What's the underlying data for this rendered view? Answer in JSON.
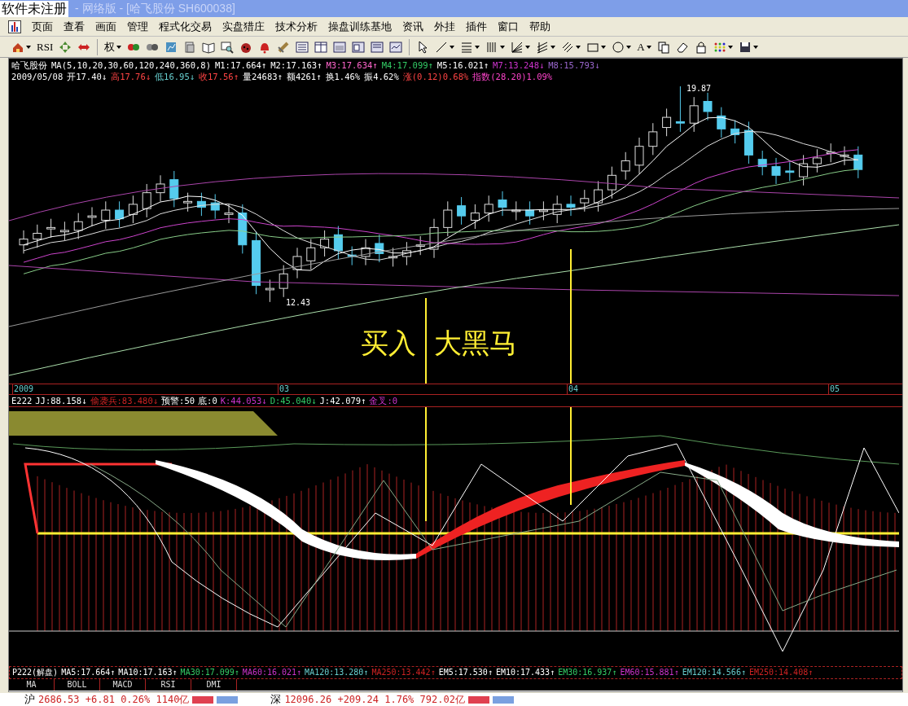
{
  "window": {
    "title_badge": "软件未注册",
    "title": "- 网络版 - [哈飞股份 SH600038]"
  },
  "menu": [
    "页面",
    "查看",
    "画面",
    "管理",
    "程式化交易",
    "实盘猎庄",
    "技术分析",
    "操盘训练基地",
    "资讯",
    "外挂",
    "插件",
    "窗口",
    "帮助"
  ],
  "toolbar": [
    {
      "kind": "icon",
      "dropdown": true
    },
    {
      "kind": "text",
      "label": "RSI",
      "dropdown": false
    },
    {
      "kind": "icon",
      "dropdown": false
    },
    {
      "kind": "icon",
      "dropdown": false
    },
    {
      "kind": "sep"
    },
    {
      "kind": "text",
      "label": "权",
      "dropdown": true
    },
    {
      "kind": "icon",
      "dropdown": false
    },
    {
      "kind": "icon",
      "dropdown": false
    },
    {
      "kind": "icon",
      "dropdown": false
    },
    {
      "kind": "icon",
      "dropdown": false
    },
    {
      "kind": "icon",
      "dropdown": false
    },
    {
      "kind": "icon",
      "dropdown": false
    },
    {
      "kind": "icon",
      "dropdown": false
    },
    {
      "kind": "icon",
      "dropdown": false
    },
    {
      "kind": "icon",
      "dropdown": false
    },
    {
      "kind": "icon",
      "dropdown": false
    },
    {
      "kind": "icon",
      "dropdown": false
    },
    {
      "kind": "icon",
      "dropdown": false
    },
    {
      "kind": "icon",
      "dropdown": false
    },
    {
      "kind": "icon",
      "dropdown": false
    },
    {
      "kind": "icon",
      "dropdown": false
    },
    {
      "kind": "sep"
    },
    {
      "kind": "icon",
      "dropdown": false
    },
    {
      "kind": "icon",
      "dropdown": true
    },
    {
      "kind": "icon",
      "dropdown": true
    },
    {
      "kind": "icon",
      "dropdown": true
    },
    {
      "kind": "icon",
      "dropdown": true
    },
    {
      "kind": "icon",
      "dropdown": true
    },
    {
      "kind": "icon",
      "dropdown": true
    },
    {
      "kind": "icon",
      "dropdown": true
    },
    {
      "kind": "icon",
      "dropdown": true
    },
    {
      "kind": "text",
      "label": "A",
      "dropdown": true
    },
    {
      "kind": "icon",
      "dropdown": false
    },
    {
      "kind": "icon",
      "dropdown": false
    },
    {
      "kind": "icon",
      "dropdown": false
    },
    {
      "kind": "icon",
      "dropdown": true
    },
    {
      "kind": "icon",
      "dropdown": true
    }
  ],
  "price_header": [
    [
      {
        "text": "哈飞股份",
        "kind": "white"
      },
      {
        "text": "MA(5,10,20,30,60,120,240,360,8)",
        "kind": "white"
      },
      {
        "text": "M1:17.664↑",
        "kind": "white"
      },
      {
        "text": "M2:17.163↑",
        "kind": "white"
      },
      {
        "text": "M3:17.634↑",
        "kind": "pink"
      },
      {
        "text": "M4:17.099↑",
        "kind": "green"
      },
      {
        "text": "M5:16.021↑",
        "kind": "white"
      },
      {
        "text": "M7:13.248↓",
        "kind": "violet"
      },
      {
        "text": "M8:15.793↓",
        "kind": "purple"
      }
    ],
    [
      {
        "text": "2009/05/08",
        "kind": "white"
      },
      {
        "text": "开17.40↓",
        "kind": "white"
      },
      {
        "text": "高17.76↓",
        "kind": "red"
      },
      {
        "text": "低16.95↓",
        "kind": "cyan"
      },
      {
        "text": "收17.56↑",
        "kind": "red"
      },
      {
        "text": "量24683↑",
        "kind": "white"
      },
      {
        "text": "额4261↑",
        "kind": "white"
      },
      {
        "text": "换1.46%",
        "kind": "white"
      },
      {
        "text": "振4.62%",
        "kind": "white"
      },
      {
        "text": "涨(0.12)0.68%",
        "kind": "red"
      },
      {
        "text": "指数(28.20)1.09%",
        "kind": "magenta"
      }
    ]
  ],
  "price_labels": {
    "high": "19.87",
    "low": "12.43"
  },
  "annotation": "买入  大黑马",
  "date_axis": [
    "2009",
    "03",
    "04",
    "05"
  ],
  "indicator_header": [
    {
      "text": "E222",
      "kind": "white"
    },
    {
      "text": "JJ:88.158↓",
      "kind": "white"
    },
    {
      "text": "偷袭兵:83.480↓",
      "kind": "crimson"
    },
    {
      "text": "预警:50",
      "kind": "white"
    },
    {
      "text": "底:0",
      "kind": "white"
    },
    {
      "text": "K:44.053↓",
      "kind": "violet"
    },
    {
      "text": "D:45.040↓",
      "kind": "green"
    },
    {
      "text": "J:42.079↑",
      "kind": "white"
    },
    {
      "text": "金叉:0",
      "kind": "violet"
    }
  ],
  "ma_footer": [
    {
      "text": "P222(解盘)",
      "kind": "white"
    },
    {
      "text": "MA5:17.664↑",
      "kind": "white"
    },
    {
      "text": "MA10:17.163↑",
      "kind": "white"
    },
    {
      "text": "MA30:17.099↑",
      "kind": "green"
    },
    {
      "text": "MA60:16.021↑",
      "kind": "violet"
    },
    {
      "text": "MA120:13.280↑",
      "kind": "cyan"
    },
    {
      "text": "MA250:13.442↑",
      "kind": "crimson"
    },
    {
      "text": "EM5:17.530↑",
      "kind": "white"
    },
    {
      "text": "EM10:17.433↑",
      "kind": "white"
    },
    {
      "text": "EM30:16.937↑",
      "kind": "green"
    },
    {
      "text": "EM60:15.881↑",
      "kind": "violet"
    },
    {
      "text": "EM120:14.566↑",
      "kind": "cyan"
    },
    {
      "text": "EM250:14.408↑",
      "kind": "crimson"
    }
  ],
  "indicator_tabs": [
    {
      "label": "MA",
      "selected": false
    },
    {
      "label": "BOLL",
      "selected": false
    },
    {
      "label": "MACD",
      "selected": false
    },
    {
      "label": "RSI",
      "selected": false
    },
    {
      "label": "DMI",
      "selected": false
    }
  ],
  "status": [
    {
      "label": "沪",
      "value": "2686.53 +6.81 0.26% 1140亿"
    },
    {
      "label": "深",
      "value": "12096.26 +209.24 1.76% 792.02亿"
    }
  ]
}
